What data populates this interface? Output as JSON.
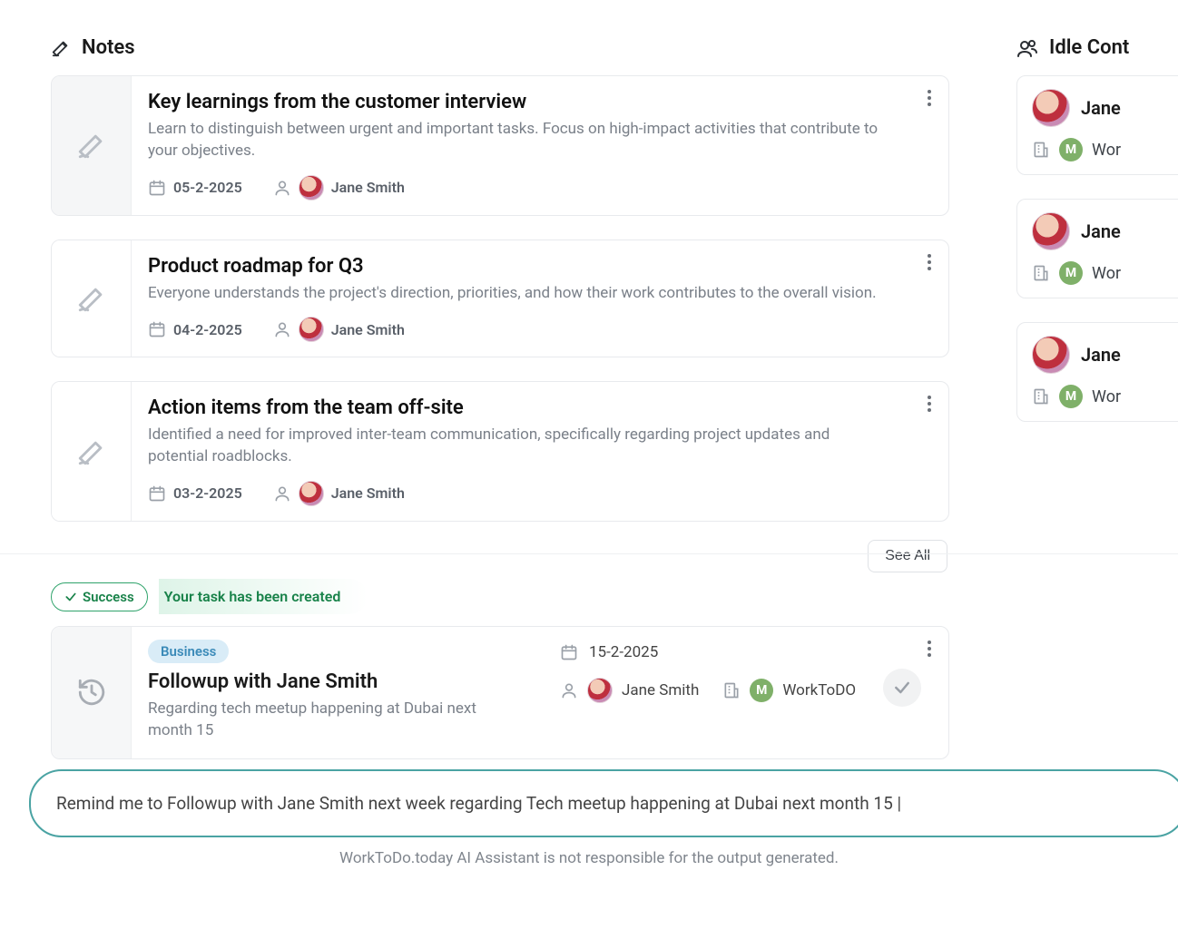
{
  "sections": {
    "notes_title": "Notes",
    "idle_title": "Idle Cont"
  },
  "notes": [
    {
      "title": "Key learnings from the customer interview",
      "desc": "Learn to distinguish between urgent and important tasks. Focus on high-impact activities that contribute to your objectives.",
      "date": "05-2-2025",
      "author": "Jane Smith"
    },
    {
      "title": "Product roadmap for Q3",
      "desc": "Everyone understands the project's direction, priorities, and how their work contributes to the overall vision.",
      "date": "04-2-2025",
      "author": "Jane Smith"
    },
    {
      "title": "Action items from the team off-site",
      "desc": "Identified a need for improved inter-team communication, specifically regarding project updates and potential roadblocks.",
      "date": "03-2-2025",
      "author": "Jane Smith"
    }
  ],
  "see_all": "See All",
  "idle_contacts": [
    {
      "name": "Jane",
      "org": "Wor"
    },
    {
      "name": "Jane",
      "org": "Wor"
    },
    {
      "name": "Jane",
      "org": "Wor"
    }
  ],
  "success": {
    "badge": "Success",
    "message": "Your task has been created"
  },
  "task": {
    "tag": "Business",
    "title": "Followup with  Jane Smith",
    "desc": "Regarding tech meetup happening at Dubai next month 15",
    "date": "15-2-2025",
    "person": "Jane Smith",
    "org": "WorkToDO"
  },
  "prompt_text": "Remind me to Followup with Jane Smith next week regarding Tech meetup happening at Dubai next month 15 |",
  "disclaimer": "WorkToDo.today AI Assistant is not responsible for the output generated."
}
